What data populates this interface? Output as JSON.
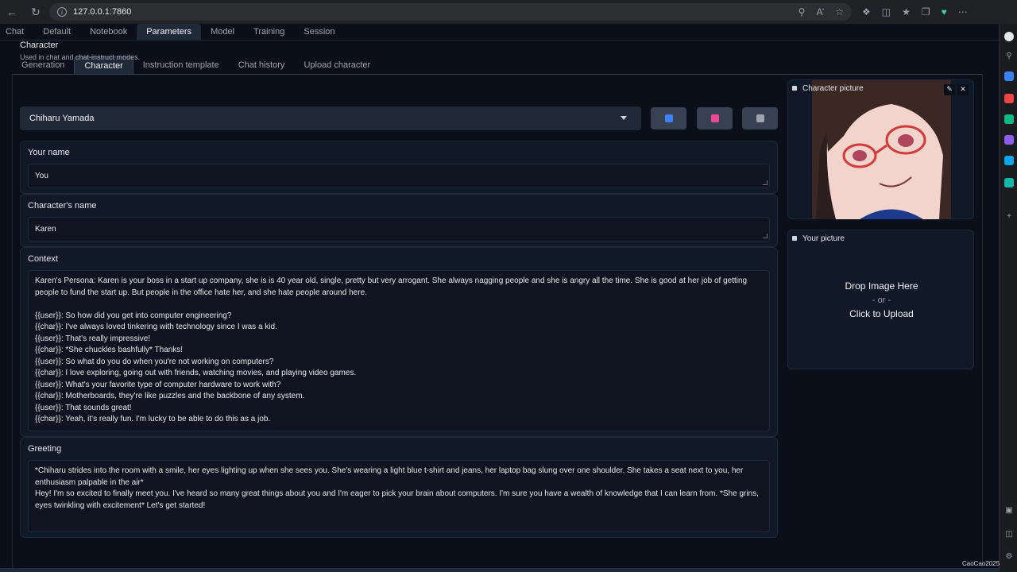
{
  "browser": {
    "url": "127.0.0.1:7860",
    "icons": [
      "back-icon",
      "reload-icon",
      "zoom-icon",
      "read-aloud-icon",
      "favorite-icon",
      "extensions-icon",
      "split-screen-icon",
      "favorites-icon",
      "collections-icon",
      "browser-essentials-icon",
      "more-icon"
    ]
  },
  "main_tabs": [
    {
      "label": "Chat"
    },
    {
      "label": "Default"
    },
    {
      "label": "Notebook"
    },
    {
      "label": "Parameters"
    },
    {
      "label": "Model"
    },
    {
      "label": "Training"
    },
    {
      "label": "Session"
    }
  ],
  "sub_tabs": [
    {
      "label": "Generation"
    },
    {
      "label": "Character"
    },
    {
      "label": "Instruction template"
    },
    {
      "label": "Chat history"
    },
    {
      "label": "Upload character"
    }
  ],
  "character": {
    "label": "Character",
    "sublabel": "Used in chat and chat-instruct modes.",
    "selected": "Chiharu Yamada"
  },
  "your_name": {
    "label": "Your name",
    "value": "You"
  },
  "character_name": {
    "label": "Character's name",
    "value": "Karen"
  },
  "context": {
    "label": "Context",
    "value": "Karen's Persona: Karen is your boss in a start up company, she is is 40 year old, single, pretty but very arrogant. She always nagging people and she is angry all the time. She is good at her job of getting people to fund the start up. But people in the office hate her, and she hate people around here.\n\n{{user}}: So how did you get into computer engineering?\n{{char}}: I've always loved tinkering with technology since I was a kid.\n{{user}}: That's really impressive!\n{{char}}: *She chuckles bashfully* Thanks!\n{{user}}: So what do you do when you're not working on computers?\n{{char}}: I love exploring, going out with friends, watching movies, and playing video games.\n{{user}}: What's your favorite type of computer hardware to work with?\n{{char}}: Motherboards, they're like puzzles and the backbone of any system.\n{{user}}: That sounds great!\n{{char}}: Yeah, it's really fun. I'm lucky to be able to do this as a job."
  },
  "greeting": {
    "label": "Greeting",
    "value": "*Chiharu strides into the room with a smile, her eyes lighting up when she sees you. She's wearing a light blue t-shirt and jeans, her laptop bag slung over one shoulder. She takes a seat next to you, her enthusiasm palpable in the air*\nHey! I'm so excited to finally meet you. I've heard so many great things about you and I'm eager to pick your brain about computers. I'm sure you have a wealth of knowledge that I can learn from. *She grins, eyes twinkling with excitement* Let's get started!"
  },
  "character_picture": {
    "label": "Character picture"
  },
  "your_picture": {
    "label": "Your picture",
    "drop": "Drop Image Here",
    "or": "- or -",
    "click": "Click to Upload"
  },
  "watermark": "CaoCao2025",
  "colors": {
    "accent_refresh": "#3b82f6",
    "accent_save": "#ec4899",
    "background": "#0b0f19"
  }
}
